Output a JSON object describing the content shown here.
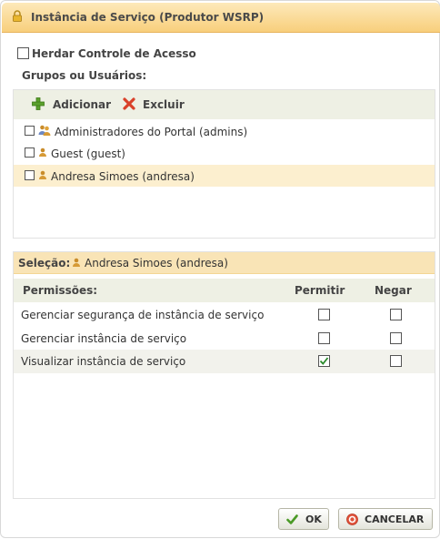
{
  "dialog": {
    "title": "Instância de Serviço (Produtor WSRP)"
  },
  "inherit": {
    "label": "Herdar Controle de Acesso",
    "checked": false
  },
  "groups": {
    "heading": "Grupos ou Usuários:",
    "add_label": "Adicionar",
    "remove_label": "Excluir",
    "items": [
      {
        "label": "Administradores do Portal (admins)",
        "icon": "group-icon",
        "selected": false
      },
      {
        "label": "Guest (guest)",
        "icon": "user-icon",
        "selected": false
      },
      {
        "label": "Andresa Simoes (andresa)",
        "icon": "user-icon",
        "selected": true
      }
    ]
  },
  "selection": {
    "label": "Seleção:",
    "value": "Andresa Simoes (andresa)"
  },
  "permissions": {
    "header": {
      "name": "Permissões:",
      "allow": "Permitir",
      "deny": "Negar"
    },
    "rows": [
      {
        "name": "Gerenciar segurança de instância de serviço",
        "allow": false,
        "deny": false
      },
      {
        "name": "Gerenciar instância de serviço",
        "allow": false,
        "deny": false
      },
      {
        "name": "Visualizar instância de serviço",
        "allow": true,
        "deny": false
      }
    ]
  },
  "buttons": {
    "ok": "OK",
    "cancel": "CANCELAR"
  },
  "colors": {
    "title_bar": "#f8cf7c",
    "selected_row": "#fcefcf",
    "toolbar_bg": "#eef0e4",
    "check_green": "#2a8a2a"
  }
}
